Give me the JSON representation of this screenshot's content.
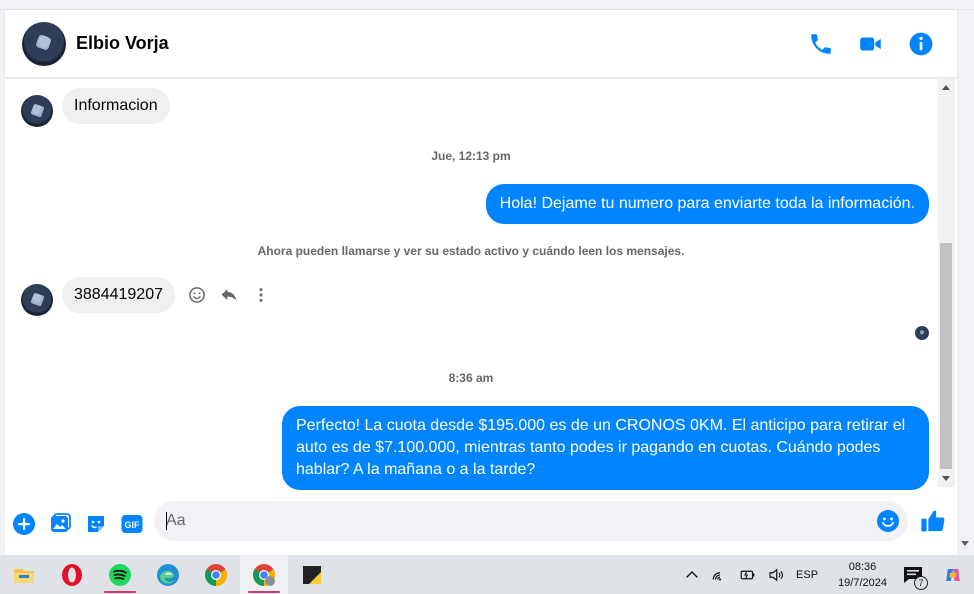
{
  "header": {
    "contact_name": "Elbio Vorja"
  },
  "messages": {
    "incoming_1": "Informacion",
    "timestamp_1": "Jue, 12:13 pm",
    "outgoing_1": "Hola! Dejame tu numero  para enviarte toda la información.",
    "system_note": "Ahora pueden llamarse y ver su estado activo y cuándo leen los mensajes.",
    "incoming_2": "3884419207",
    "timestamp_2": "8:36 am",
    "outgoing_2": "Perfecto! La cuota desde $195.000 es de un CRONOS 0KM. El anticipo para retirar el auto es de $7.100.000, mientras tanto podes ir pagando en cuotas. Cuándo podes hablar? A la mañana o a la tarde?"
  },
  "composer": {
    "placeholder": "Aa",
    "gif_label": "GIF"
  },
  "taskbar": {
    "language": "ESP",
    "time": "08:36",
    "date": "19/7/2024",
    "notification_count": "7"
  },
  "colors": {
    "accent": "#0084ff",
    "incoming_bubble": "#f0f0f0",
    "taskbar": "#dfe3e8"
  }
}
